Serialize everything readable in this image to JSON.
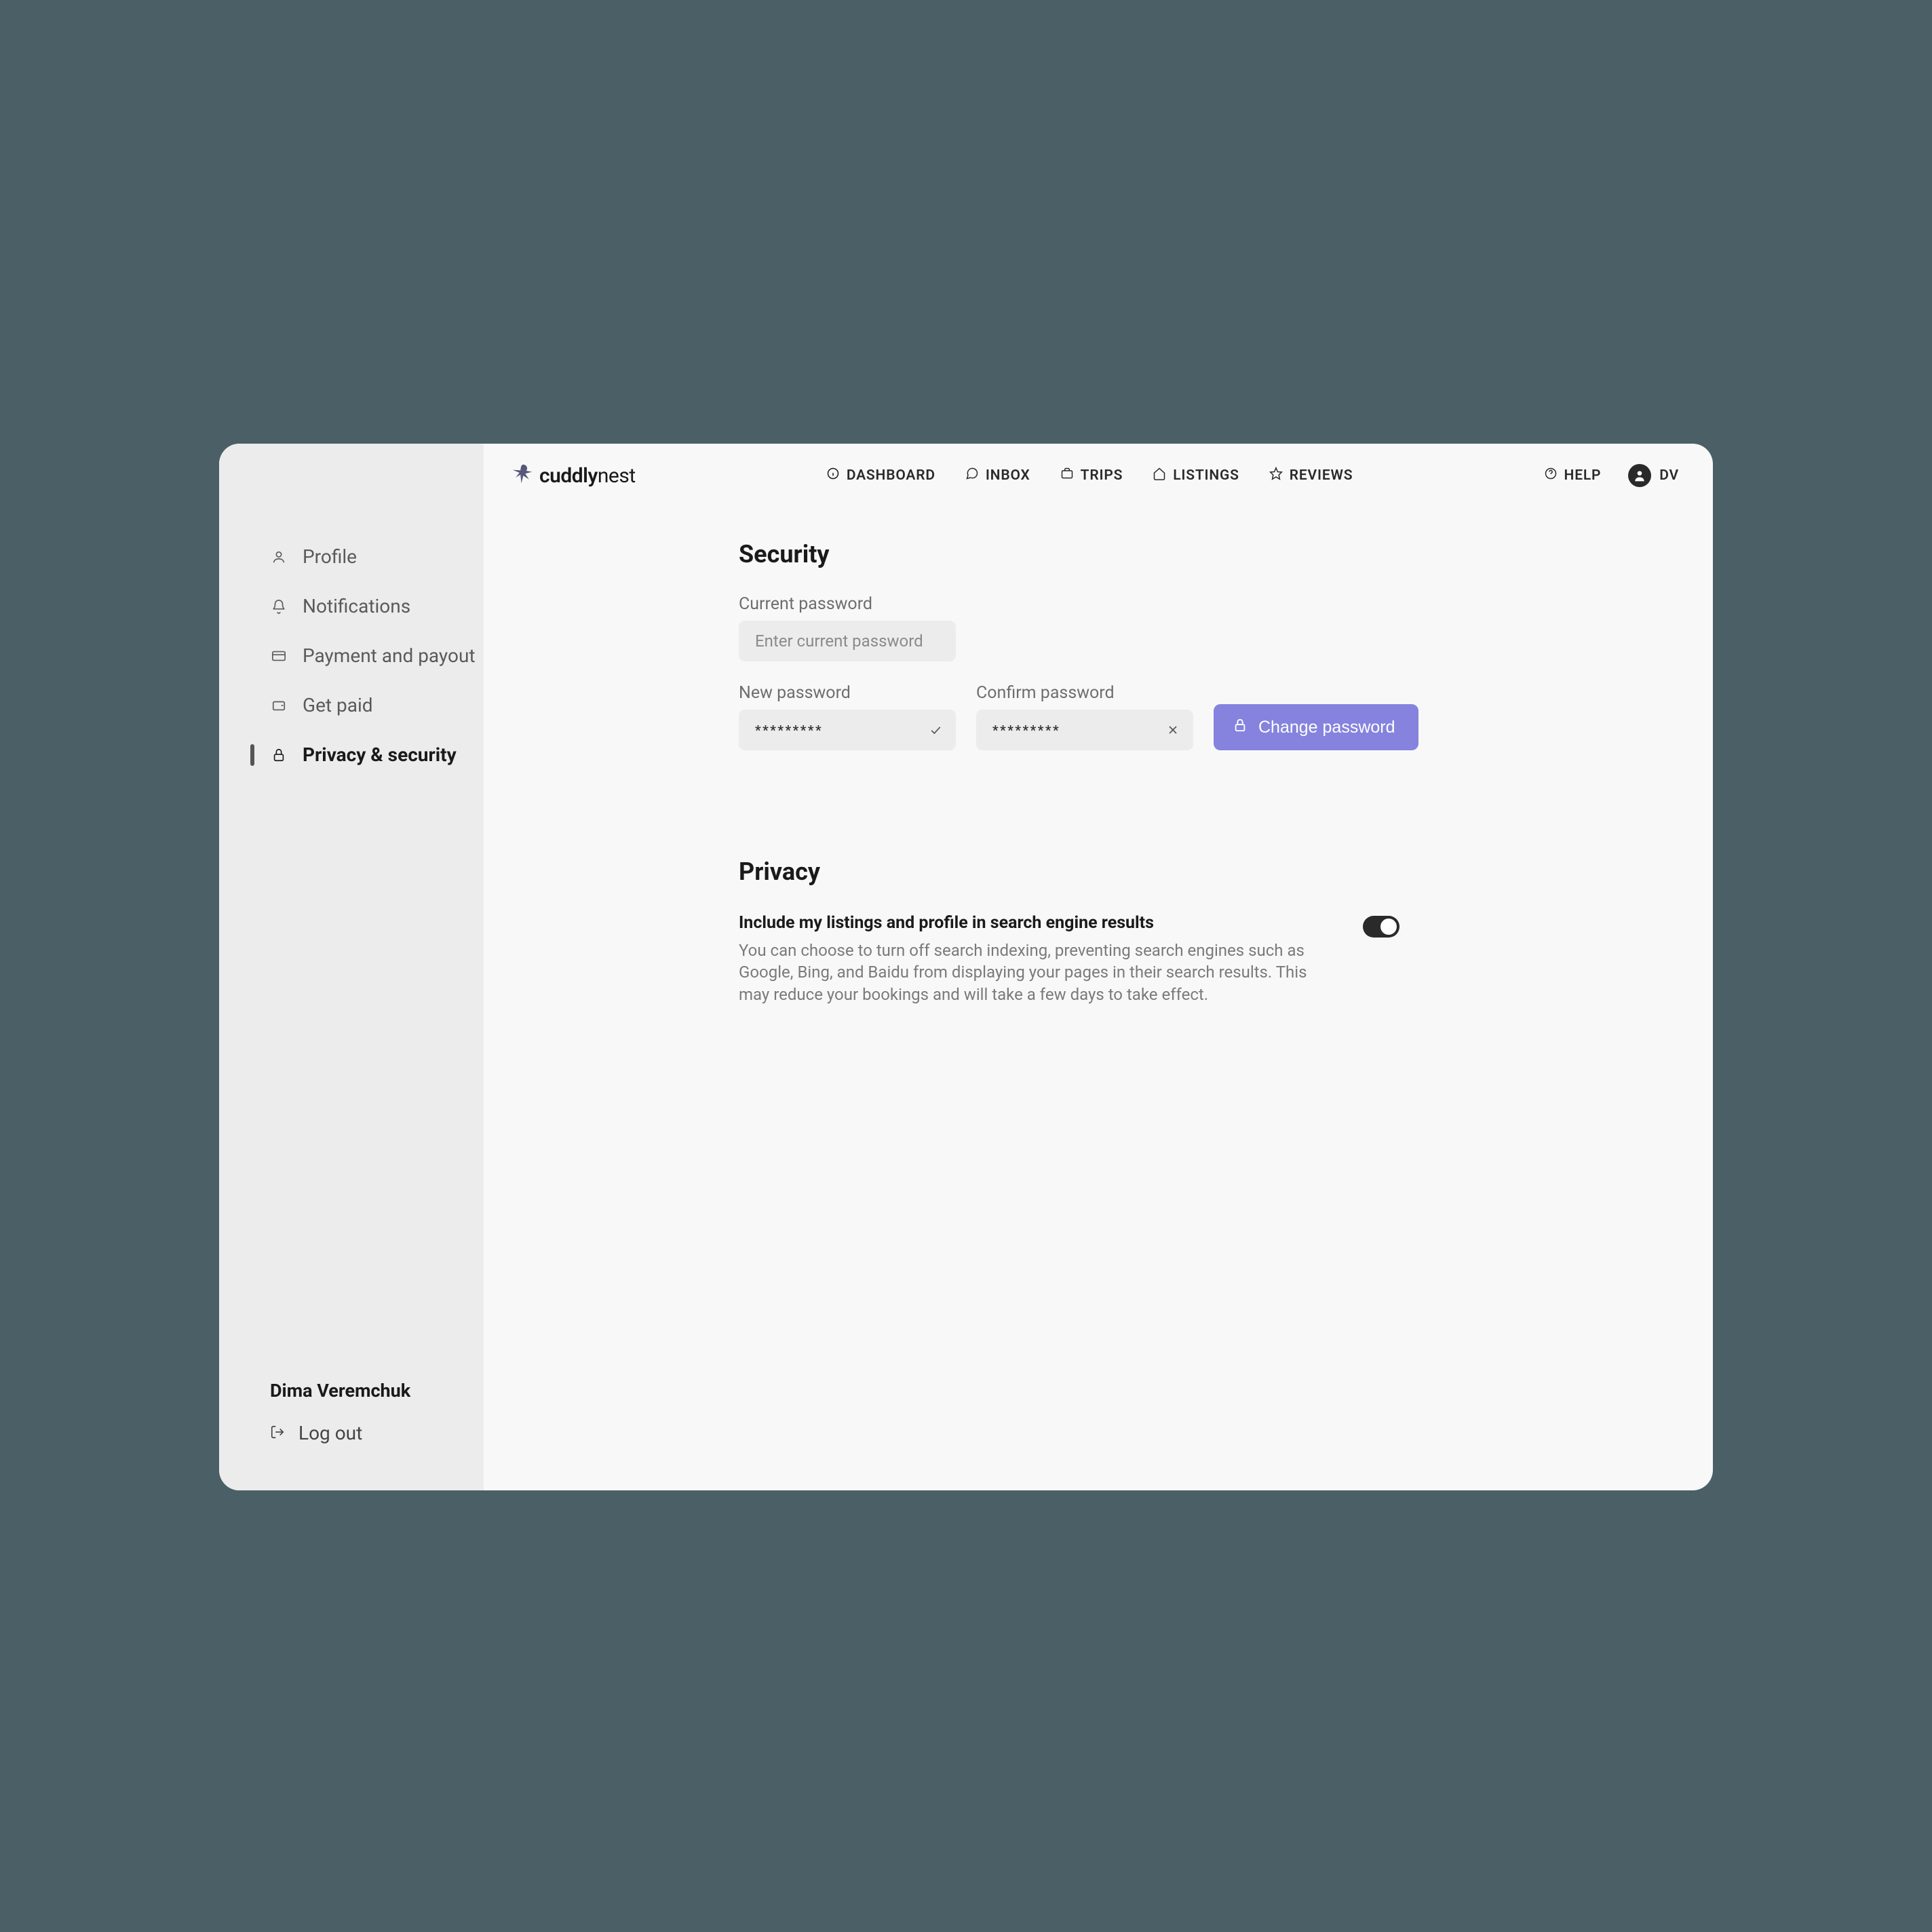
{
  "brand": {
    "name_bold": "cuddly",
    "name_light": "nest"
  },
  "topnav": {
    "dashboard": "DASHBOARD",
    "inbox": "INBOX",
    "trips": "TRIPS",
    "listings": "LISTINGS",
    "reviews": "REVIEWS"
  },
  "help_label": "HELP",
  "avatar_initials": "DV",
  "sidebar": {
    "items": [
      {
        "label": "Profile"
      },
      {
        "label": "Notifications"
      },
      {
        "label": "Payment and payout"
      },
      {
        "label": "Get paid"
      },
      {
        "label": "Privacy & security"
      }
    ],
    "user_name": "Dima Veremchuk",
    "logout_label": "Log out"
  },
  "security": {
    "title": "Security",
    "current_label": "Current password",
    "current_placeholder": "Enter current password",
    "new_label": "New password",
    "new_mask": "*********",
    "confirm_label": "Confirm password",
    "confirm_mask": "*********",
    "button_label": "Change password"
  },
  "privacy": {
    "title": "Privacy",
    "subtitle": "Include my listings and profile in search engine results",
    "description": "You can choose to turn off search indexing, preventing search engines such as Google, Bing, and Baidu from displaying your pages in their search results. This may reduce your bookings and will take a few days to take effect.",
    "toggle_on": true
  }
}
